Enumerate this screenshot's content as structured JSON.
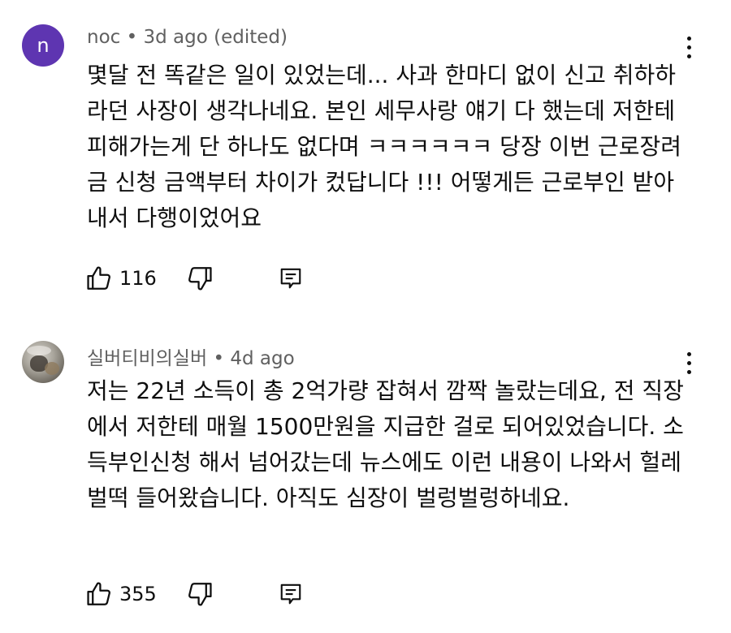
{
  "comments": [
    {
      "avatar_letter": "n",
      "author": "noc",
      "time": "3d ago (edited)",
      "text": "몇달 전 똑같은 일이 있었는데... 사과 한마디 없이 신고 취하하라던 사장이 생각나네요. 본인 세무사랑 얘기 다 했는데 저한테 피해가는게 단 하나도 없다며 ㅋㅋㅋㅋㅋㅋ 당장 이번 근로장려금 신청 금액부터 차이가 컸답니다 !!! 어떻게든 근로부인 받아내서 다행이었어요",
      "likes": "116"
    },
    {
      "author": "실버티비의실버",
      "time": "4d ago",
      "text": "저는 22년 소득이 총 2억가량 잡혀서 깜짝 놀랐는데요, 전 직장에서 저한테 매월 1500만원을 지급한 걸로 되어있었습니다. 소득부인신청 해서 넘어갔는데 뉴스에도 이런 내용이 나와서 헐레벌떡 들어왔습니다. 아직도 심장이 벌렁벌렁하네요.",
      "likes": "355"
    }
  ],
  "colors": {
    "avatar_bg": "#5e35b1",
    "meta": "#606060",
    "text": "#0f0f0f"
  },
  "icons": [
    "thumbs-up-icon",
    "thumbs-down-icon",
    "reply-icon",
    "more-vert-icon"
  ]
}
